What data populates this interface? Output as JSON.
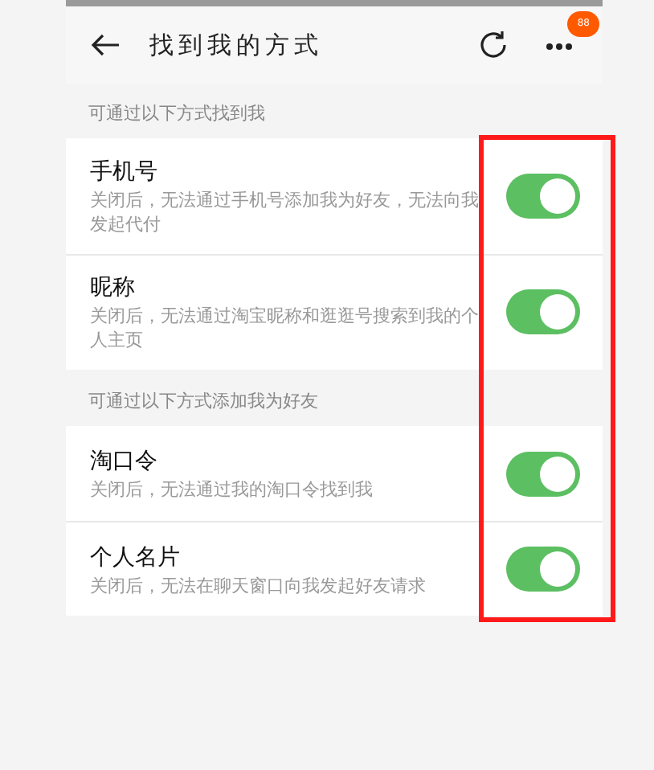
{
  "header": {
    "title": "找到我的方式",
    "badge": "88"
  },
  "sections": [
    {
      "label": "可通过以下方式找到我",
      "items": [
        {
          "title": "手机号",
          "description": "关闭后，无法通过手机号添加我为好友，无法向我发起代付",
          "on": true
        },
        {
          "title": "昵称",
          "description": "关闭后，无法通过淘宝昵称和逛逛号搜索到我的个人主页",
          "on": true
        }
      ]
    },
    {
      "label": "可通过以下方式添加我为好友",
      "items": [
        {
          "title": "淘口令",
          "description": "关闭后，无法通过我的淘口令找到我",
          "on": true
        },
        {
          "title": "个人名片",
          "description": "关闭后，无法在聊天窗口向我发起好友请求",
          "on": true
        }
      ]
    }
  ]
}
